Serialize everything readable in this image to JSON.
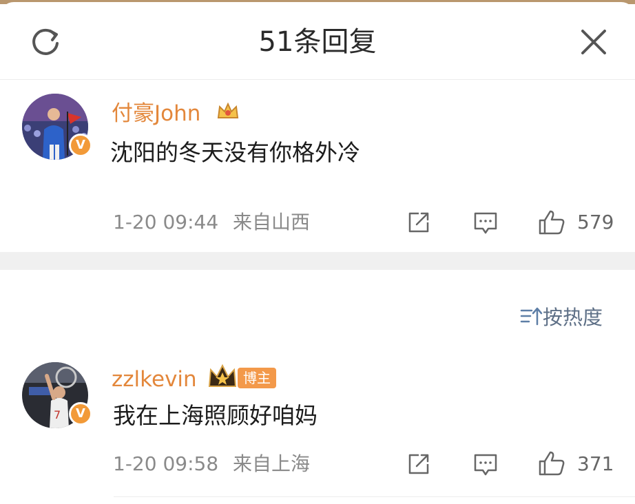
{
  "header": {
    "title": "51条回复"
  },
  "comments": [
    {
      "username": "付豪John",
      "text": "沈阳的冬天没有你格外冷",
      "time": "1-20 09:44",
      "location": "来自山西",
      "likes": "579"
    },
    {
      "username": "zzlkevin",
      "badge": "博主",
      "text": "我在上海照顾好咱妈",
      "time": "1-20 09:58",
      "location": "来自上海",
      "likes": "371"
    }
  ],
  "sort": {
    "label": "按热度"
  },
  "colors": {
    "username": "#e3873b",
    "verified": "#f29a38",
    "sort": "#5d6f86"
  },
  "icons": [
    "refresh-icon",
    "close-icon",
    "share-icon",
    "comment-icon",
    "like-icon",
    "sort-icon",
    "verified-badge-icon",
    "crown-icon"
  ]
}
